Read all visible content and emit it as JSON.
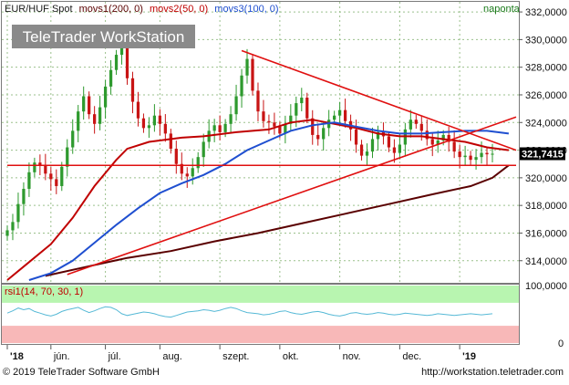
{
  "chart_data": [
    {
      "type": "candlestick",
      "title_parts": [
        {
          "text": "EUR/HUF Spot",
          "color": "#1a1a1a"
        },
        {
          "text": "movs1(200, 0)",
          "color": "#5a0000"
        },
        {
          "text": "movs2(50, 0)",
          "color": "#c00000"
        },
        {
          "text": "movs3(100, 0)",
          "color": "#1f4fd0"
        }
      ],
      "period_label": "naponta",
      "watermark": "TeleTrader WorkStation",
      "ylim": [
        312.4,
        332.6
      ],
      "y_ticks": [
        "332,0000",
        "330,0000",
        "328,0000",
        "326,0000",
        "324,0000",
        "322,0000",
        "320,0000",
        "318,0000",
        "316,0000",
        "314,0000"
      ],
      "y_tick_values": [
        332,
        330,
        328,
        326,
        324,
        322,
        320,
        318,
        316,
        314
      ],
      "last_value_label": "321,7415",
      "last_value": 321.74,
      "close_series": [
        316.2,
        316.8,
        318.1,
        319.2,
        320.4,
        321.1,
        320.9,
        320.3,
        319.9,
        319.4,
        320.8,
        322.2,
        323.4,
        324.8,
        325.9,
        324.6,
        323.9,
        325.1,
        326.6,
        327.8,
        328.9,
        329.6,
        327.2,
        325.5,
        324.3,
        323.6,
        323.8,
        324.5,
        323.9,
        323.2,
        322.1,
        321.0,
        320.3,
        320.1,
        320.7,
        321.5,
        322.6,
        323.4,
        323.8,
        323.3,
        323.9,
        324.6,
        325.9,
        327.4,
        328.6,
        326.3,
        324.8,
        324.1,
        324.0,
        323.7,
        323.2,
        323.9,
        324.5,
        325.4,
        325.8,
        324.3,
        323.1,
        322.8,
        323.6,
        324.2,
        324.5,
        324.9,
        324.1,
        323.5,
        322.4,
        321.6,
        321.9,
        322.8,
        323.3,
        323.0,
        322.2,
        321.8,
        322.4,
        323.5,
        324.2,
        323.9,
        323.4,
        322.8,
        322.4,
        322.7,
        323.1,
        322.6,
        321.9,
        321.5,
        321.6,
        321.3,
        321.5,
        321.8,
        321.7,
        321.74
      ],
      "ma_series": [
        {
          "name": "movs1(200, 0)",
          "color": "#5a0000",
          "points": [
            [
              7,
              312.9
            ],
            [
              15,
              313.6
            ],
            [
              22,
              314.2
            ],
            [
              30,
              314.7
            ],
            [
              38,
              315.4
            ],
            [
              46,
              316.0
            ],
            [
              54,
              316.7
            ],
            [
              62,
              317.4
            ],
            [
              70,
              318.1
            ],
            [
              78,
              318.8
            ],
            [
              85,
              319.4
            ],
            [
              89,
              320.0
            ],
            [
              92,
              320.9
            ]
          ]
        },
        {
          "name": "movs2(50, 0)",
          "color": "#c00000",
          "points": [
            [
              0,
              312.6
            ],
            [
              4,
              313.9
            ],
            [
              8,
              315.2
            ],
            [
              12,
              317.1
            ],
            [
              16,
              319.4
            ],
            [
              20,
              321.3
            ],
            [
              22,
              322.1
            ],
            [
              26,
              322.6
            ],
            [
              32,
              322.9
            ],
            [
              36,
              323.0
            ],
            [
              42,
              323.3
            ],
            [
              48,
              323.5
            ],
            [
              52,
              324.0
            ],
            [
              56,
              324.2
            ],
            [
              60,
              323.9
            ],
            [
              64,
              323.6
            ],
            [
              68,
              323.2
            ],
            [
              72,
              323.0
            ],
            [
              76,
              323.0
            ],
            [
              80,
              322.8
            ],
            [
              84,
              322.6
            ],
            [
              88,
              322.2
            ],
            [
              92,
              322.0
            ]
          ]
        },
        {
          "name": "movs3(100, 0)",
          "color": "#1f4fd0",
          "points": [
            [
              4,
              312.6
            ],
            [
              8,
              313.1
            ],
            [
              12,
              314.0
            ],
            [
              16,
              315.3
            ],
            [
              20,
              316.6
            ],
            [
              24,
              317.8
            ],
            [
              28,
              318.9
            ],
            [
              32,
              319.6
            ],
            [
              36,
              320.2
            ],
            [
              40,
              321.0
            ],
            [
              44,
              322.0
            ],
            [
              48,
              322.7
            ],
            [
              52,
              323.4
            ],
            [
              56,
              323.8
            ],
            [
              60,
              324.0
            ],
            [
              64,
              323.7
            ],
            [
              68,
              323.4
            ],
            [
              72,
              323.2
            ],
            [
              76,
              323.2
            ],
            [
              80,
              323.3
            ],
            [
              84,
              323.4
            ],
            [
              88,
              323.4
            ],
            [
              92,
              323.2
            ]
          ]
        }
      ],
      "trend_lines": [
        {
          "color": "#e01010",
          "points": [
            [
              0,
              320.9
            ],
            [
              95,
              320.9
            ]
          ]
        },
        {
          "color": "#e01010",
          "points": [
            [
              43,
              329.2
            ],
            [
              95,
              322.0
            ]
          ]
        },
        {
          "color": "#e01010",
          "points": [
            [
              11,
              313.0
            ],
            [
              95,
              324.4
            ]
          ]
        }
      ]
    },
    {
      "type": "line",
      "title": "rsi1(14, 70, 30, 1)",
      "ylim": [
        0,
        100
      ],
      "y_ticks": [
        "100,0000",
        "0"
      ],
      "y_tick_values": [
        100,
        0
      ],
      "zones": [
        {
          "from": 70,
          "to": 100,
          "color": "#b8f5b0"
        },
        {
          "from": 0,
          "to": 30,
          "color": "#f8b8b8"
        }
      ],
      "series": [
        {
          "color": "#56b9d6",
          "values": [
            52,
            56,
            61,
            58,
            60,
            55,
            52,
            49,
            47,
            50,
            55,
            58,
            60,
            62,
            57,
            53,
            56,
            60,
            63,
            62,
            58,
            51,
            48,
            50,
            52,
            54,
            53,
            51,
            48,
            46,
            45,
            48,
            51,
            54,
            55,
            56,
            58,
            57,
            55,
            57,
            60,
            62,
            60,
            56,
            53,
            52,
            51,
            49,
            50,
            52,
            55,
            56,
            53,
            51,
            50,
            52,
            54,
            55,
            53,
            50,
            48,
            47,
            49,
            52,
            53,
            51,
            50,
            51,
            53,
            52,
            50,
            49,
            50,
            52,
            51,
            50,
            49,
            48,
            49,
            51,
            50,
            49,
            48,
            49,
            50,
            51,
            50,
            49,
            50,
            51
          ]
        }
      ]
    }
  ],
  "x_axis": {
    "labels": [
      "'18",
      "jún.",
      "júl.",
      "aug.",
      "szept.",
      "okt.",
      "nov.",
      "dec.",
      "'19"
    ],
    "label_index": [
      0,
      8,
      18,
      28,
      39,
      50,
      61,
      72,
      83
    ]
  },
  "footer": {
    "copyright": "© 2019 TeleTrader Software GmbH",
    "url": "http://workstation.teletrader.com"
  },
  "colors": {
    "panel_border": "#7a7a7a",
    "grid": "#9bc08c",
    "bull": "#2e9a2e",
    "bear": "#c81414",
    "last_value_bg": "#000000"
  }
}
